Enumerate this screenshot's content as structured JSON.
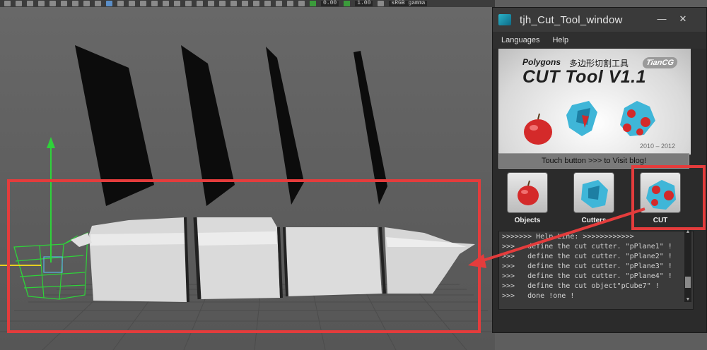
{
  "toolbar": {
    "field_1": "0.00",
    "field_2": "1.00",
    "colorspace": "sRGB gamma"
  },
  "window": {
    "title": "tjh_Cut_Tool_window",
    "menu": [
      "Languages",
      "Help"
    ]
  },
  "banner": {
    "brand": "Polygons",
    "subtitle_cn": "多边形切割工具",
    "logo": "TianCG",
    "title": "CUT Tool V1.1",
    "years": "2010 – 2012"
  },
  "visit_button": "Touch button >>> to Visit blog!",
  "tools": [
    {
      "label": "Objects",
      "icon": "apple-icon"
    },
    {
      "label": "Cutters",
      "icon": "cutter-shards-icon"
    },
    {
      "label": "CUT",
      "icon": "cut-apple-icon"
    }
  ],
  "log": {
    "lines": [
      ">>>>>>> Help Line: >>>>>>>>>>>>",
      ">>>   define the cut cutter. \"pPlane1\" !",
      ">>>   define the cut cutter. \"pPlane2\" !",
      ">>>   define the cut cutter. \"pPlane3\" !",
      ">>>   define the cut cutter. \"pPlane4\" !",
      ">>>   define the cut object\"pCube7\" !",
      ">>>   done !one !"
    ]
  },
  "colors": {
    "annotation": "#e43c3c",
    "manipulator": "#2fd23a",
    "viewport": "#5e5e5e",
    "window_bg": "#2b2b2b"
  }
}
